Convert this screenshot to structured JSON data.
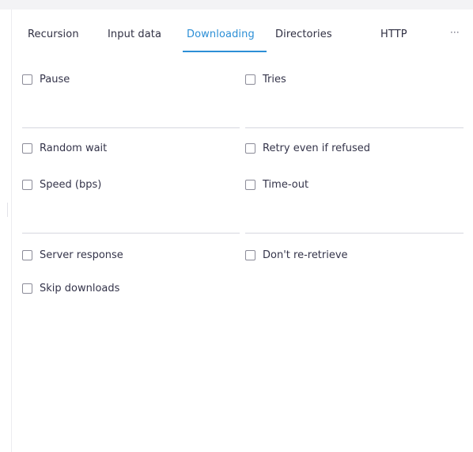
{
  "tabs": [
    {
      "label": "Recursion",
      "active": false
    },
    {
      "label": "Input data",
      "active": false
    },
    {
      "label": "Downloading",
      "active": true
    },
    {
      "label": "Directories",
      "active": false
    },
    {
      "label": "HTTP",
      "active": false
    },
    {
      "label": "···",
      "active": false
    }
  ],
  "options": {
    "pause": {
      "label": "Pause",
      "checked": false
    },
    "tries": {
      "label": "Tries",
      "checked": false
    },
    "random_wait": {
      "label": "Random wait",
      "checked": false
    },
    "retry_refused": {
      "label": "Retry even if refused",
      "checked": false
    },
    "speed": {
      "label": "Speed (bps)",
      "checked": false
    },
    "timeout": {
      "label": "Time-out",
      "checked": false
    },
    "server_response": {
      "label": "Server response",
      "checked": false
    },
    "no_retrieve": {
      "label": "Don't re-retrieve",
      "checked": false
    },
    "skip_downloads": {
      "label": "Skip downloads",
      "checked": false
    }
  },
  "colors": {
    "accent": "#2c8fd6",
    "text": "#34344a",
    "divider": "#d6d7df"
  }
}
